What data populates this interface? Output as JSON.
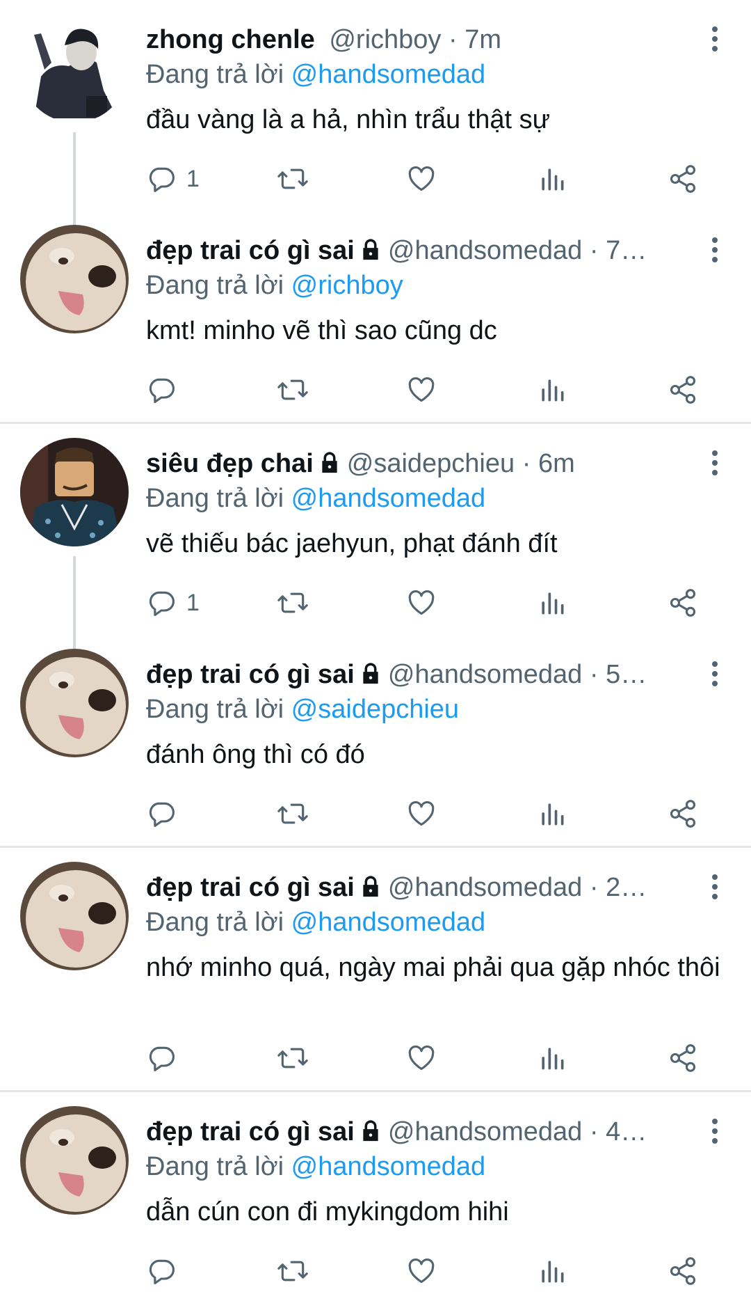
{
  "colors": {
    "link": "#1d9bf0",
    "secondary": "#536471",
    "divider": "#e1e6ea",
    "text": "#0f1419"
  },
  "tweets": [
    {
      "name": "zhong chenle",
      "locked": false,
      "handle": "@richboy",
      "time": "7m",
      "replying_label": "Đang trả lời",
      "replying_to": "@handsomedad",
      "text": "đầu vàng là a hả, nhìn trẩu thật sự",
      "reply_count": "1",
      "avatar": "person-photo"
    },
    {
      "name": "đẹp trai có gì sai",
      "locked": true,
      "handle": "@handsomedad",
      "time": "7…",
      "replying_label": "Đang trả lời",
      "replying_to": "@richboy",
      "text": "kmt! minho vẽ thì sao cũng dc",
      "reply_count": "",
      "avatar": "dog-photo"
    },
    {
      "name": "siêu đẹp chai",
      "locked": true,
      "handle": "@saidepchieu",
      "time": "6m",
      "replying_label": "Đang trả lời",
      "replying_to": "@handsomedad",
      "text": "vẽ thiếu bác jaehyun, phạt đánh đít",
      "reply_count": "1",
      "avatar": "roblox-photo"
    },
    {
      "name": "đẹp trai có gì sai",
      "locked": true,
      "handle": "@handsomedad",
      "time": "5…",
      "replying_label": "Đang trả lời",
      "replying_to": "@saidepchieu",
      "text": "đánh ông thì có đó",
      "reply_count": "",
      "avatar": "dog-photo"
    },
    {
      "name": "đẹp trai có gì sai",
      "locked": true,
      "handle": "@handsomedad",
      "time": "2…",
      "replying_label": "Đang trả lời",
      "replying_to": "@handsomedad",
      "text": "nhớ minho quá, ngày mai phải qua gặp nhóc thôi",
      "reply_count": "",
      "avatar": "dog-photo"
    },
    {
      "name": "đẹp trai có gì sai",
      "locked": true,
      "handle": "@handsomedad",
      "time": "4…",
      "replying_label": "Đang trả lời",
      "replying_to": "@handsomedad",
      "text": "dẫn cún con đi mykingdom hihi",
      "reply_count": "",
      "avatar": "dog-photo"
    }
  ]
}
